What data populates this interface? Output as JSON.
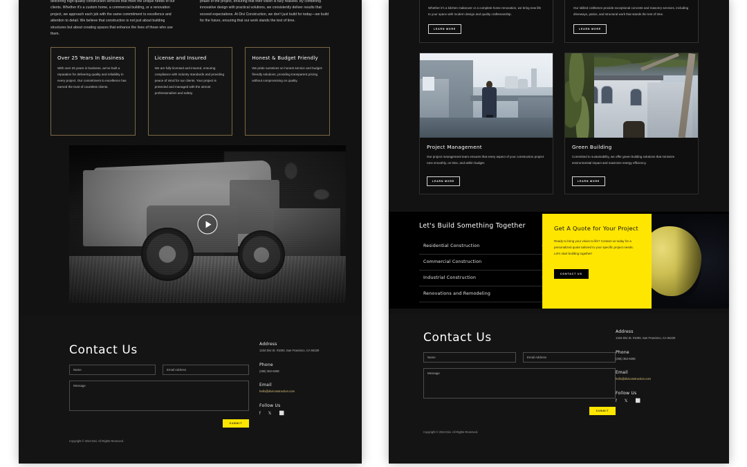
{
  "left_panel": {
    "intro": {
      "col1": "delivering high-quality construction services that meet the unique needs of our clients. Whether it's a custom home, a commercial building, or a renovation project, we approach each job with the same commitment to excellence and attention to detail. We believe that construction is not just about building structures but about creating spaces that enhance the lives of those who use them.",
      "col2": "phase of the project, ensuring that their vision is fully realized. By combining innovative design with practical solutions, we consistently deliver results that exceed expectations. At Divi Construction, we don't just build for today—we build for the future, ensuring that our work stands the test of time."
    },
    "feature_cards": [
      {
        "title": "Over 25 Years In Business",
        "text": "With over 25 years in business, we've built a reputation for delivering quality and reliability in every project. Our commitment to excellence has earned the trust of countless clients."
      },
      {
        "title": "License and Insured",
        "text": "We are fully licensed and insured, ensuring compliance with industry standards and providing peace of mind for our clients. Your project is protected and managed with the utmost professionalism and safety."
      },
      {
        "title": "Honest & Budget Friendly",
        "text": "We pride ourselves on honest service and budget-friendly solutions, providing transparent pricing without compromising on quality."
      }
    ],
    "video": {
      "play_label": "play-button",
      "alt": "Black and white CAT telehandler on a construction site"
    }
  },
  "right_panel": {
    "service_text_cards": [
      {
        "text": "Whether it's a kitchen makeover or a complete home renovation, we bring new life to your space with modern design and quality craftsmanship.",
        "button": "LEARN MORE"
      },
      {
        "text": "Our skilled craftsmen provide exceptional concrete and masonry services, including driveways, patios, and structural work that stands the test of time.",
        "button": "LEARN MORE"
      }
    ],
    "service_image_cards": [
      {
        "title": "Project Management",
        "text": "Our project management team ensures that every aspect of your construction project runs smoothly, on time, and within budget.",
        "button": "LEARN MORE",
        "alt": "Businessman standing on a rooftop overlooking the city"
      },
      {
        "title": "Green Building",
        "text": "Committed to sustainability, we offer green building solutions that minimize environmental impact and maximize energy efficiency.",
        "button": "LEARN MORE",
        "alt": "Victorian style house surrounded by trees"
      }
    ],
    "cta": {
      "heading": "Let's Build Something Together",
      "accordion": [
        {
          "label": "Residential Construction",
          "toggle": "+"
        },
        {
          "label": "Commercial Construction",
          "toggle": "+"
        },
        {
          "label": "Industrial Construction",
          "toggle": "+"
        },
        {
          "label": "Renovations and Remodeling",
          "toggle": "+"
        }
      ],
      "quote": {
        "heading": "Get A Quote for Your Project",
        "text": "Ready to bring your vision to life? Contact us today for a personalized quote tailored to your specific project needs. Let's start building together!",
        "button": "CONTACT US"
      },
      "helmet_alt": "Yellow construction hard hat"
    }
  },
  "contact": {
    "heading": "Contact Us",
    "fields": {
      "name_placeholder": "Name",
      "email_placeholder": "Email Address",
      "message_placeholder": "Message"
    },
    "submit_label": "SUBMIT",
    "info": {
      "address_label": "Address",
      "address_value": "1234 Divi St. #1000, San Francisco, CA 94220",
      "phone_label": "Phone",
      "phone_value": "(255) 352-6258",
      "email_label": "Email",
      "email_value": "hello@diviconstruction.com",
      "follow_label": "Follow Us",
      "socials": [
        {
          "name": "facebook-icon",
          "glyph": "f"
        },
        {
          "name": "x-twitter-icon",
          "glyph": "𝕏"
        },
        {
          "name": "instagram-icon",
          "glyph": "⬜"
        }
      ]
    },
    "copyright": "Copyright © 2024 Divi. All Rights Reserved."
  },
  "colors": {
    "accent_yellow": "#ffe600",
    "card_border_gold": "#7e6a46",
    "panel_bg": "#121212",
    "section_black": "#000000",
    "email_link": "#d8c07a"
  }
}
